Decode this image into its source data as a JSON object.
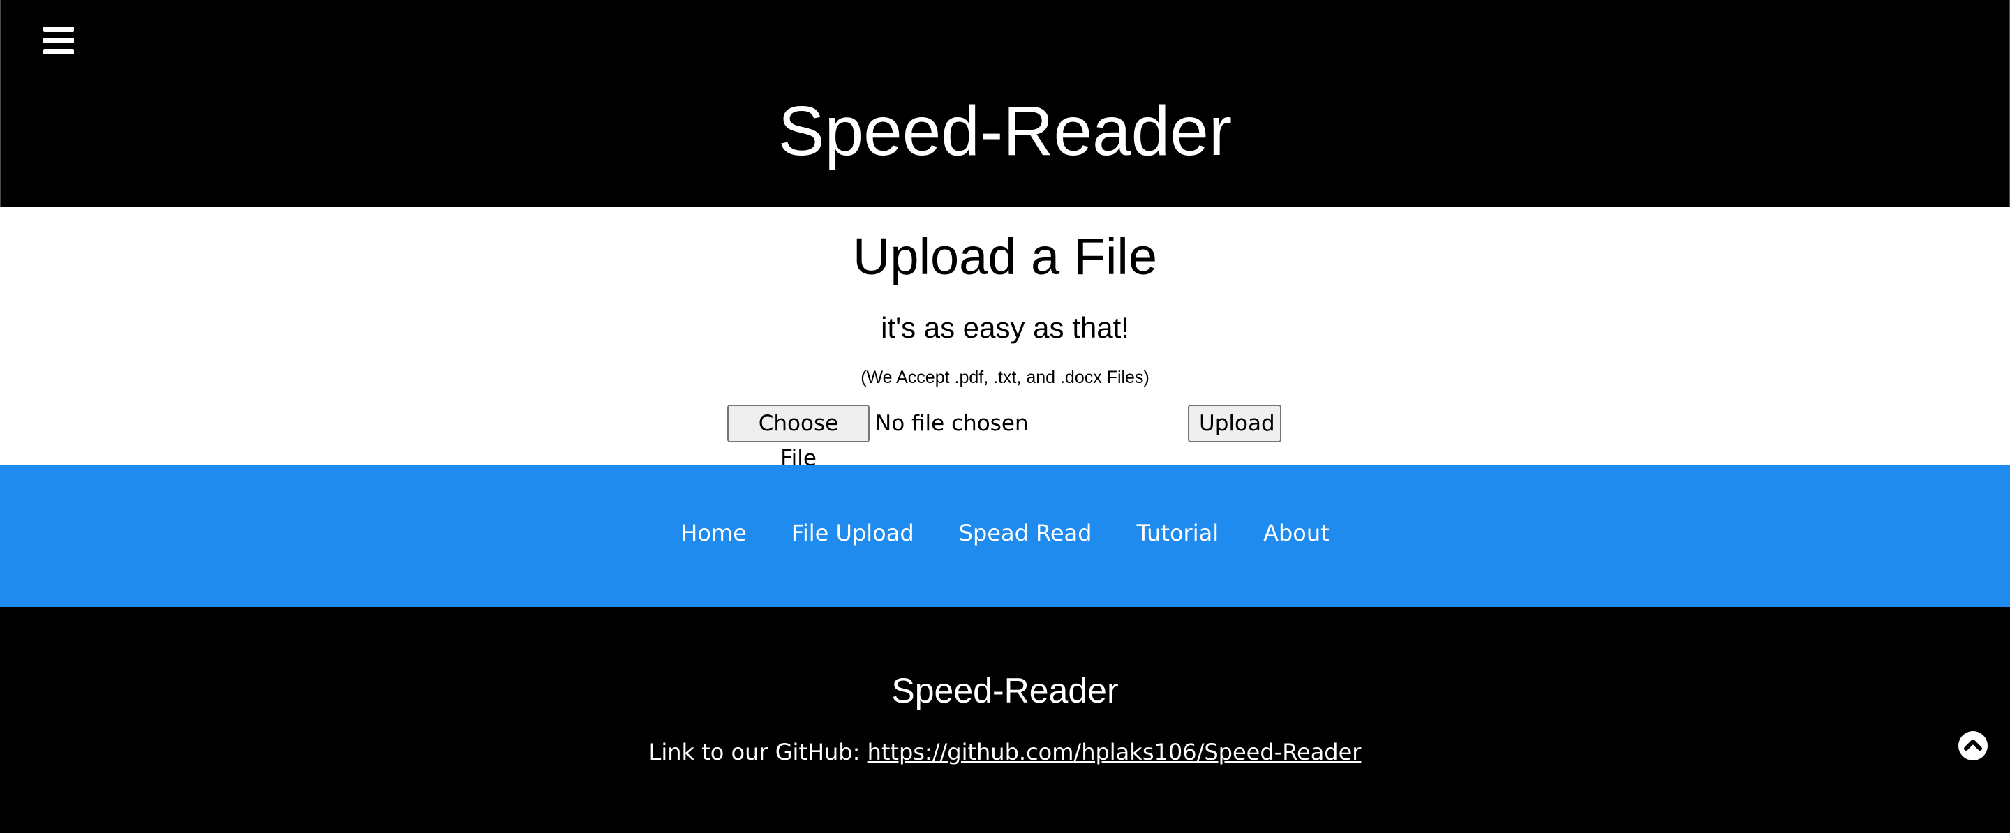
{
  "header": {
    "menu_icon": "hamburger-menu-icon",
    "title": "Speed-Reader"
  },
  "upload": {
    "title": "Upload a File",
    "subtitle": "it's as easy as that!",
    "accepted_note": "(We Accept .pdf, .txt, and .docx Files)",
    "choose_label": "Choose File",
    "file_status": "No file chosen",
    "upload_label": "Upload"
  },
  "nav": {
    "items": [
      {
        "label": "Home"
      },
      {
        "label": "File Upload"
      },
      {
        "label": "Spead Read"
      },
      {
        "label": "Tutorial"
      },
      {
        "label": "About"
      }
    ]
  },
  "footer": {
    "title": "Speed-Reader",
    "github_prefix": "Link to our GitHub: ",
    "github_url": "https://github.com/hplaks106/Speed-Reader",
    "to_top_icon": "chevron-up-circle-icon"
  },
  "colors": {
    "header_bg": "#000000",
    "nav_bg": "#1f8bef",
    "footer_bg": "#000000",
    "text_light": "#ffffff"
  }
}
